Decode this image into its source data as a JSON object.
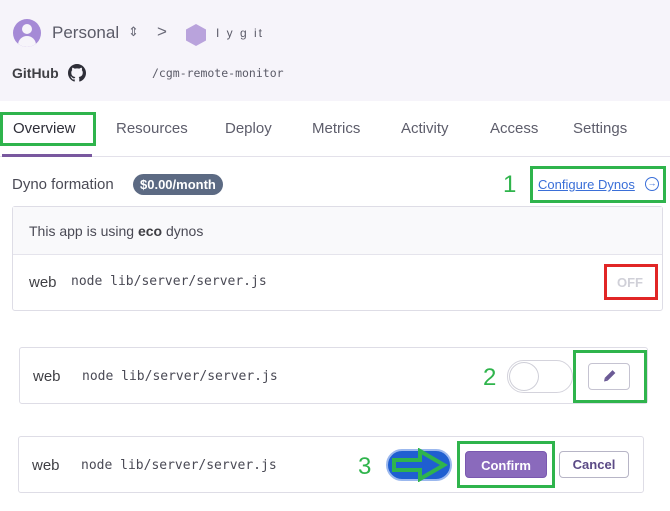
{
  "header": {
    "account": "Personal",
    "account_switch_icon": "up-down-chevron-icon",
    "breadcrumb_separator": ">",
    "app_name": "I  y  g    it",
    "github_label": "GitHub",
    "repo_path": "/cgm-remote-monitor"
  },
  "tabs": [
    {
      "label": "Overview",
      "active": true
    },
    {
      "label": "Resources"
    },
    {
      "label": "Deploy"
    },
    {
      "label": "Metrics"
    },
    {
      "label": "Activity"
    },
    {
      "label": "Access"
    },
    {
      "label": "Settings"
    }
  ],
  "dyno_formation": {
    "title": "Dyno formation",
    "price": "$0.00/month",
    "configure_link": "Configure Dynos",
    "eco_prefix": "This app is using ",
    "eco_word": "eco",
    "eco_suffix": " dynos"
  },
  "dynos": [
    {
      "type": "web",
      "command": "node lib/server/server.js",
      "status": "OFF"
    },
    {
      "type": "web",
      "command": "node lib/server/server.js",
      "toggle": "off"
    },
    {
      "type": "web",
      "command": "node lib/server/server.js",
      "toggle": "on"
    }
  ],
  "actions": {
    "confirm": "Confirm",
    "cancel": "Cancel"
  },
  "annotations": {
    "step1": "1",
    "step2": "2",
    "step3": "3"
  },
  "colors": {
    "accent": "#79589f",
    "annotation_green": "#2fb44c",
    "annotation_red": "#e12626",
    "link": "#3a6fd8"
  }
}
